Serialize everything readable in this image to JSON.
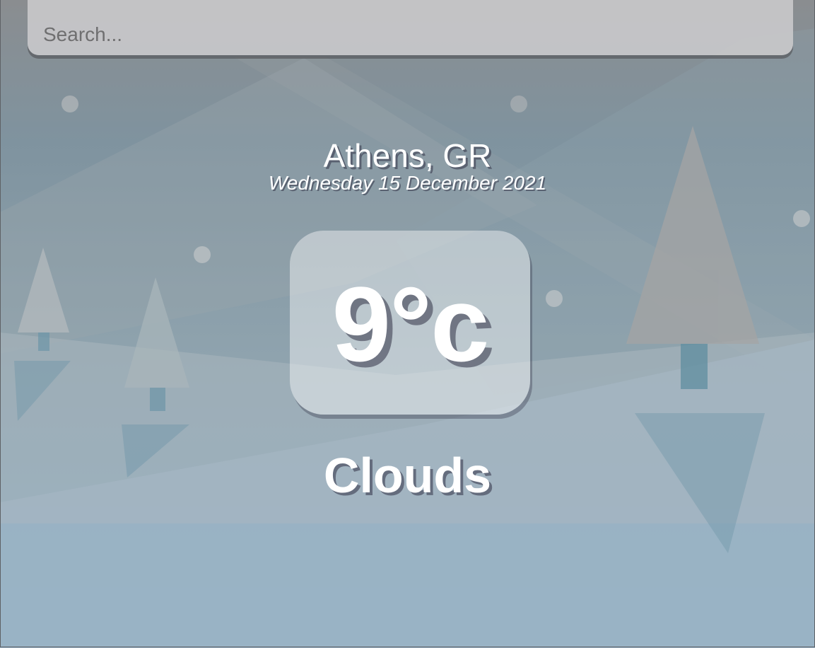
{
  "search": {
    "placeholder": "Search...",
    "value": ""
  },
  "location": {
    "city": "Athens, GR",
    "date": "Wednesday 15 December 2021"
  },
  "weather": {
    "temperature": "9°c",
    "condition": "Clouds"
  },
  "colors": {
    "sky_top": "#8a8d90",
    "sky_bottom": "#8aaec8",
    "text": "#ffffff",
    "search_bg": "#c8c8ca"
  }
}
